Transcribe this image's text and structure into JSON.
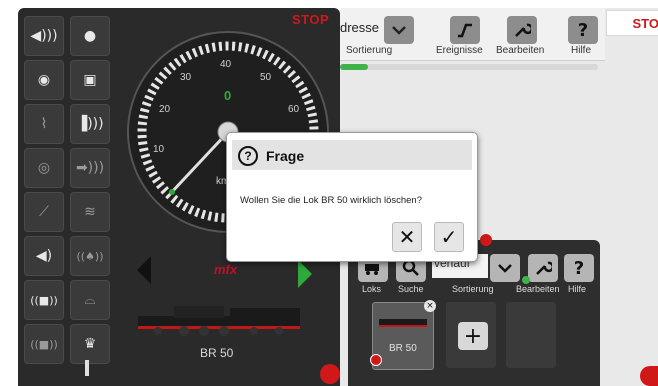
{
  "left_panel": {
    "stop_label": "STOP",
    "function_buttons": [
      {
        "icon": "speaker-sound-icon",
        "glyph": "◀)))"
      },
      {
        "icon": "dot-light-icon",
        "glyph": "●"
      },
      {
        "icon": "speaker-circle-icon",
        "glyph": "◉"
      },
      {
        "icon": "train-front-icon",
        "glyph": "▣"
      },
      {
        "icon": "rail-signal-icon",
        "glyph": "⌇"
      },
      {
        "icon": "horn-icon",
        "glyph": "▐)))"
      },
      {
        "icon": "radio-wheel-icon",
        "glyph": "◎"
      },
      {
        "icon": "whistle-icon",
        "glyph": "➡)))"
      },
      {
        "icon": "pantograph-icon",
        "glyph": "⟋"
      },
      {
        "icon": "wave-icon",
        "glyph": "≋"
      },
      {
        "icon": "speaker-left-icon",
        "glyph": "◀)"
      },
      {
        "icon": "bell-icon",
        "glyph": "((♠))"
      },
      {
        "icon": "sound-loco-icon",
        "glyph": "((■))"
      },
      {
        "icon": "coupler-icon",
        "glyph": "⌓"
      },
      {
        "icon": "sound-loco-2-icon",
        "glyph": "((■))"
      },
      {
        "icon": "crown-icon",
        "glyph": "♛"
      }
    ],
    "gauge": {
      "speed_value": "0",
      "unit": "km",
      "ticks": [
        "10",
        "20",
        "30",
        "40",
        "50",
        "60"
      ]
    },
    "direction": {
      "back_icon": "arrow-left-icon",
      "forward_icon": "arrow-right-icon",
      "brand": "mfx"
    },
    "loco_name": "BR 50"
  },
  "topbar": {
    "address_fragment": "dresse",
    "sort_label": "Sortierung",
    "events_label": "Ereignisse",
    "edit_label": "Bearbeiten",
    "help_label": "Hilfe",
    "help_glyph": "?",
    "stop_label": "STO"
  },
  "dialog": {
    "title": "Frage",
    "title_icon_glyph": "?",
    "message": "Wollen Sie die Lok BR 50 wirklich löschen?",
    "cancel_glyph": "✕",
    "confirm_glyph": "✓"
  },
  "loco_list": {
    "sort_value": "verlauf",
    "locos_label": "Loks",
    "search_label": "Suche",
    "sort_label": "Sortierung",
    "edit_label": "Bearbeiten",
    "help_label": "Hilfe",
    "help_glyph": "?",
    "tile_name": "BR 50",
    "add_glyph": "+"
  },
  "colors": {
    "stop_red": "#d01818",
    "panel_dark": "#2a2a2a",
    "progress_green": "#3fb34a",
    "speed_green": "#2faa3a"
  }
}
